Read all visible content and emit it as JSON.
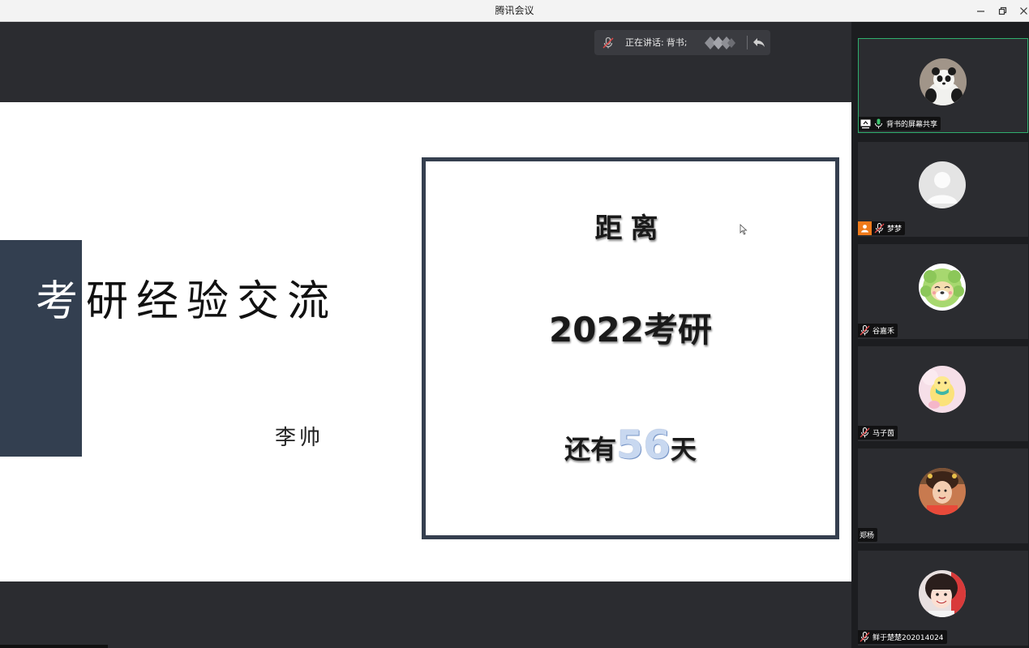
{
  "window": {
    "title": "腾讯会议",
    "minimize_icon": "minimize-icon",
    "restore_icon": "restore-icon",
    "close_icon": "close-icon"
  },
  "speaking_bar": {
    "prefix": "正在讲话:",
    "speaker": "背书;",
    "icon": "muted-mic-icon"
  },
  "slide": {
    "title_chars": [
      "考",
      "研",
      "经",
      "验",
      "交",
      "流"
    ],
    "author": "李帅",
    "countdown": {
      "line1": "距离",
      "line2": "2022考研",
      "prefix": "还有",
      "days": "56",
      "suffix": "天"
    }
  },
  "participants": [
    {
      "name": "背书的屏幕共享",
      "mic": "mic-on-icon",
      "badge": "screen-share-icon",
      "avatar": "panda",
      "active": true
    },
    {
      "name": "梦梦",
      "mic": "mic-muted-icon",
      "badge": "host-user-icon",
      "avatar": "default-person"
    },
    {
      "name": "谷嘉禾",
      "mic": "mic-muted-icon",
      "avatar": "cabbage-dog"
    },
    {
      "name": "马子茵",
      "mic": "mic-muted-icon",
      "avatar": "chick-mask"
    },
    {
      "name": "郑杨",
      "avatar": "girl-portrait"
    },
    {
      "name": "鲜于楚楚202014024",
      "mic": "mic-muted-icon",
      "avatar": "girl-smile"
    }
  ],
  "colors": {
    "active_border": "#2fae6e",
    "slide_block": "#333f50",
    "days_number": "#c8d8f0"
  }
}
